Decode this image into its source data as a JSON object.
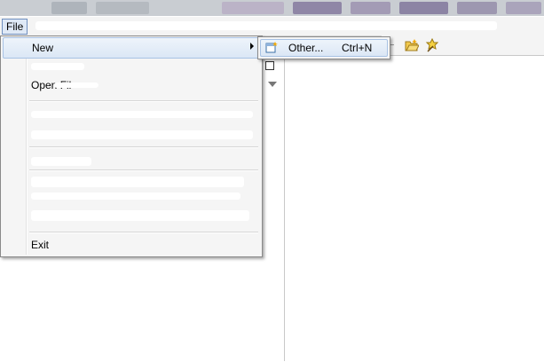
{
  "menubar": {
    "file_label": "File"
  },
  "file_menu": {
    "items": [
      {
        "label": "New",
        "shortcut": "",
        "has_submenu": true
      },
      {
        "label": "Open Fil",
        "shortcut": ""
      },
      {
        "label": "Exit",
        "shortcut": ""
      }
    ]
  },
  "new_submenu": {
    "items": [
      {
        "label": "Other...",
        "shortcut": "Ctrl+N",
        "icon": "new-wizard-icon"
      }
    ]
  },
  "colors": {
    "menu_bg": "#f5f5f5",
    "highlight_border": "#a8c2e4",
    "highlight_fill": "#dbe7f5",
    "file_menu_active": "#dfe9f6"
  }
}
